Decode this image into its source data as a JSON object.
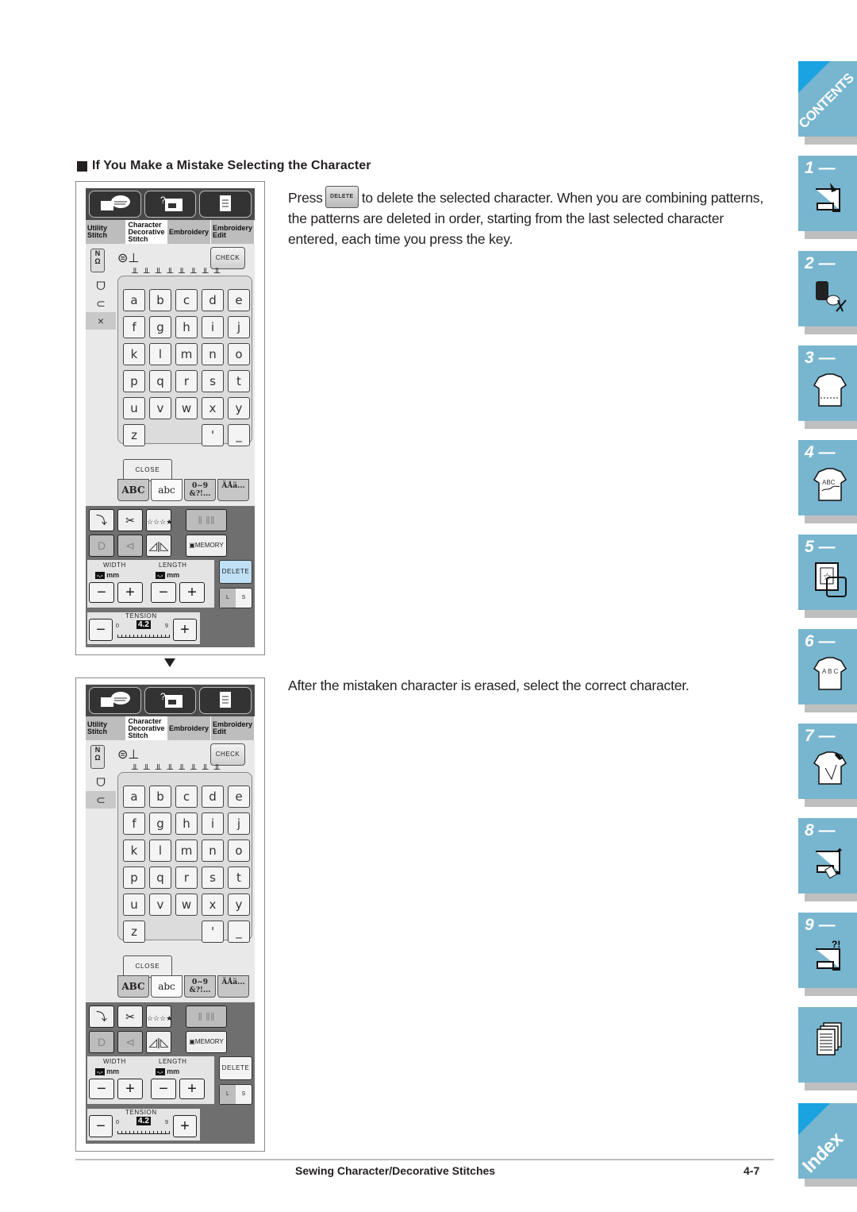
{
  "section": {
    "heading": "If You Make a Mistake Selecting the Character",
    "para1_before": "Press",
    "para1_key": "DELETE",
    "para1_after": "to delete the selected character. When you are combining patterns, the patterns are deleted in order, starting from the last selected character entered, each time you press the key.",
    "para2": "After the mistaken character is erased, select the correct character."
  },
  "screen": {
    "tabs": [
      "Utility Stitch",
      "Character Decorative Stitch",
      "Embroidery",
      "Embroidery Edit"
    ],
    "active_tab": "Character Decorative Stitch",
    "presser_foot": "N",
    "check_label": "CHECK",
    "spools": "ÌÌÌÌÌÌÌÌ",
    "keys": [
      "a",
      "b",
      "c",
      "d",
      "e",
      "f",
      "g",
      "h",
      "i",
      "j",
      "k",
      "l",
      "m",
      "n",
      "o",
      "p",
      "q",
      "r",
      "s",
      "t",
      "u",
      "v",
      "w",
      "x",
      "y",
      "z",
      "",
      "",
      "'",
      "_"
    ],
    "close_label": "CLOSE",
    "char_tabs": [
      "ABC",
      "abc",
      "0~9 &?!...",
      "ÄÅä..."
    ],
    "active_char_tab": "abc",
    "memory_label": "MEMORY",
    "width_label": "WIDTH",
    "length_label": "LENGTH",
    "width_value": "-.-",
    "length_value": "-.-",
    "unit": "mm",
    "delete_label": "DELETE",
    "ls_left": "L",
    "ls_right": "S",
    "tension_label": "TENSION",
    "tension_value": "4.2",
    "tension_min": "0",
    "tension_max": "9",
    "minus": "−",
    "plus": "+"
  },
  "screen1": {
    "side_icons": [
      "ᗜ",
      "⊂",
      "×"
    ],
    "selected_side_icon": "×",
    "delete_highlight": "#bfe0f5"
  },
  "screen2": {
    "side_icons": [
      "ᗜ",
      "⊂"
    ],
    "selected_side_icon": "⊂"
  },
  "side_tabs": [
    {
      "label": "CONTENTS",
      "kind": "contents"
    },
    {
      "label": "1 —",
      "icon": "sewing-machine-icon"
    },
    {
      "label": "2 —",
      "icon": "thread-spool-scissors-icon"
    },
    {
      "label": "3 —",
      "icon": "shirt-straight-stitch-icon"
    },
    {
      "label": "4 —",
      "icon": "shirt-embroidery-abc-icon"
    },
    {
      "label": "5 —",
      "icon": "embroidery-frame-star-icon"
    },
    {
      "label": "6 —",
      "icon": "shirt-curved-abc-icon"
    },
    {
      "label": "7 —",
      "icon": "shirt-edit-pencil-icon"
    },
    {
      "label": "8 —",
      "icon": "machine-maintenance-icon"
    },
    {
      "label": "9 —",
      "icon": "machine-troubleshoot-icon"
    },
    {
      "label": "",
      "icon": "documents-icon"
    },
    {
      "label": "Index",
      "kind": "index"
    }
  ],
  "colors": {
    "tab_blue": "#78b5cf",
    "corner_blue": "#1aa3e0",
    "delete_highlight": "#bfe0f5"
  },
  "footer": {
    "title": "Sewing Character/Decorative Stitches",
    "page": "4-7"
  }
}
